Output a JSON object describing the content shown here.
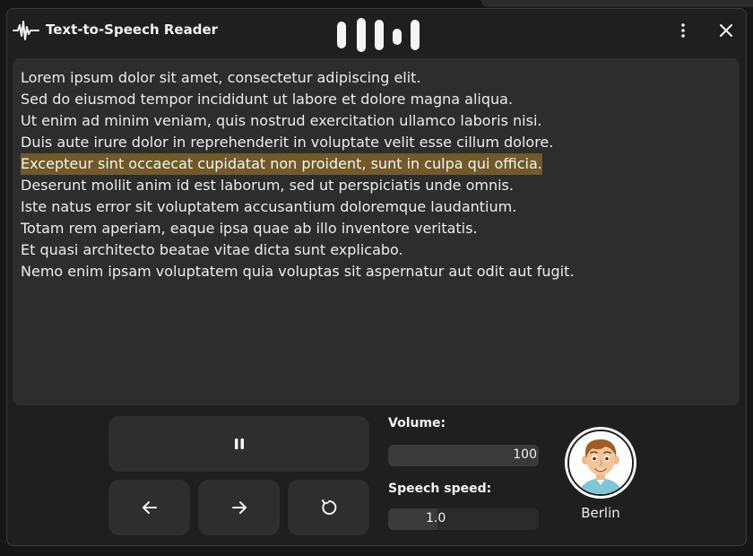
{
  "window": {
    "title": "Text-to-Speech Reader",
    "app_icon": "waveform-icon",
    "menu_icon": "more-vertical-icon",
    "close_icon": "close-icon"
  },
  "document": {
    "lines": [
      "Lorem ipsum dolor sit amet, consectetur adipiscing elit.",
      "Sed do eiusmod tempor incididunt ut labore et dolore magna aliqua.",
      "Ut enim ad minim veniam, quis nostrud exercitation ullamco laboris nisi.",
      "Duis aute irure dolor in reprehenderit in voluptate velit esse cillum dolore.",
      "Excepteur sint occaecat cupidatat non proident, sunt in culpa qui officia.",
      "Deserunt mollit anim id est laborum, sed ut perspiciatis unde omnis.",
      "Iste natus error sit voluptatem accusantium doloremque laudantium.",
      "Totam rem aperiam, eaque ipsa quae ab illo inventore veritatis.",
      "Et quasi architecto beatae vitae dicta sunt explicabo.",
      "Nemo enim ipsam voluptatem quia voluptas sit aspernatur aut odit aut fugit."
    ],
    "highlighted_line_index": 4
  },
  "controls": {
    "pause_icon": "pause-icon",
    "back_icon": "arrow-left-icon",
    "forward_icon": "arrow-right-icon",
    "restart_icon": "restart-icon"
  },
  "volume": {
    "label": "Volume:",
    "value": "100",
    "fraction": 1.0
  },
  "speed": {
    "label": "Speech speed:",
    "value": "1.0",
    "fraction": 0.33
  },
  "voice": {
    "name": "Berlin",
    "avatar_icon": "avatar-icon"
  },
  "colors": {
    "background": "#1f1f1f",
    "panel": "#2d2d2d",
    "highlight": "#72592a",
    "text": "#ececec"
  }
}
